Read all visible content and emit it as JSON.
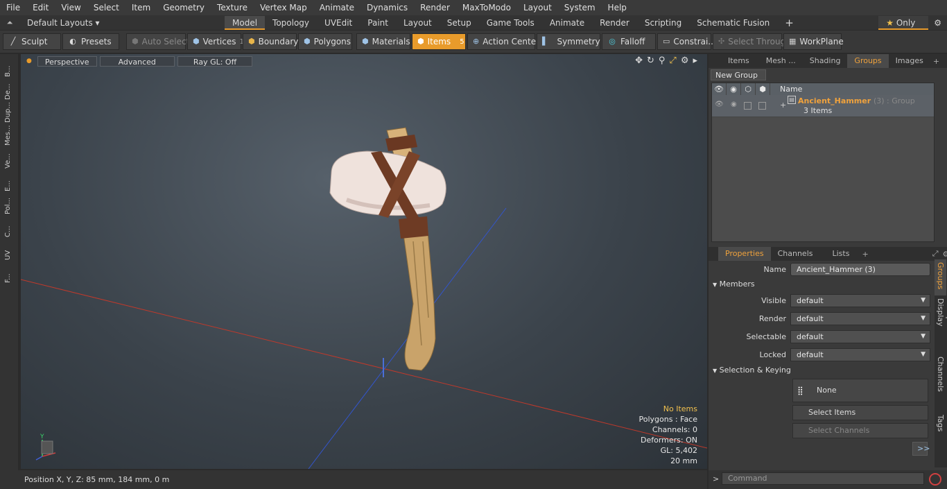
{
  "menu": [
    "File",
    "Edit",
    "View",
    "Select",
    "Item",
    "Geometry",
    "Texture",
    "Vertex Map",
    "Animate",
    "Dynamics",
    "Render",
    "MaxToModo",
    "Layout",
    "System",
    "Help"
  ],
  "layouts": {
    "selector": "Default Layouts ▾",
    "tabs": [
      "Model",
      "Topology",
      "UVEdit",
      "Paint",
      "Layout",
      "Setup",
      "Game Tools",
      "Animate",
      "Render",
      "Scripting",
      "Schematic Fusion"
    ],
    "active": "Model",
    "add": "+",
    "only_label": "Only",
    "gear": "⚙"
  },
  "toolbar": {
    "sculpt": "Sculpt",
    "presets": "Presets",
    "auto_select": "Auto Select",
    "vertices": "Vertices",
    "vertices_count": "1",
    "boundary": "Boundary",
    "polygons": "Polygons",
    "materials": "Materials",
    "items": "Items",
    "items_count": "5",
    "action_center": "Action Center",
    "symmetry": "Symmetry",
    "falloff": "Falloff",
    "constraints": "Constrai...",
    "select_through": "Select Through",
    "workplane": "WorkPlane"
  },
  "left_strip": [
    "B...",
    "De...",
    "Dup...",
    "Mes...",
    "Ve...",
    "E...",
    "Pol...",
    "C...",
    "UV",
    "F..."
  ],
  "viewport": {
    "view": "Perspective",
    "mode": "Advanced",
    "raygl": "Ray GL: Off",
    "hud": {
      "items": "No Items",
      "polygons": "Polygons : Face",
      "channels": "Channels: 0",
      "deformers": "Deformers: ON",
      "gl": "GL: 5,402",
      "scale": "20 mm"
    },
    "axis_y": "Y"
  },
  "status": {
    "position": "Position X, Y, Z:  85 mm, 184 mm, 0 m"
  },
  "right_top_tabs": [
    "Items",
    "Mesh ...",
    "Shading",
    "Groups",
    "Images"
  ],
  "right_top_active": "Groups",
  "groups": {
    "new_group": "New Group",
    "col_name": "Name",
    "row_name": "Ancient_Hammer",
    "row_meta": "(3) : Group",
    "row_sub": "3 Items"
  },
  "props_tabs": [
    "Properties",
    "Channels",
    "Lists"
  ],
  "props_active": "Properties",
  "props": {
    "name_label": "Name",
    "name_value": "Ancient_Hammer (3)",
    "members": "Members",
    "visible_label": "Visible",
    "visible_value": "default",
    "render_label": "Render",
    "render_value": "default",
    "selectable_label": "Selectable",
    "selectable_value": "default",
    "locked_label": "Locked",
    "locked_value": "default",
    "sel_keying": "Selection & Keying",
    "none": "None",
    "select_items": "Select Items",
    "select_channels": "Select Channels",
    "more": ">>"
  },
  "side_tabs": [
    "Groups",
    "Group Display",
    "User Channels",
    "Tags"
  ],
  "side_active": "Groups",
  "command": {
    "prompt": ">",
    "placeholder": "Command"
  },
  "colors": {
    "accent": "#e89b2b",
    "group_name": "#f0a23c"
  }
}
